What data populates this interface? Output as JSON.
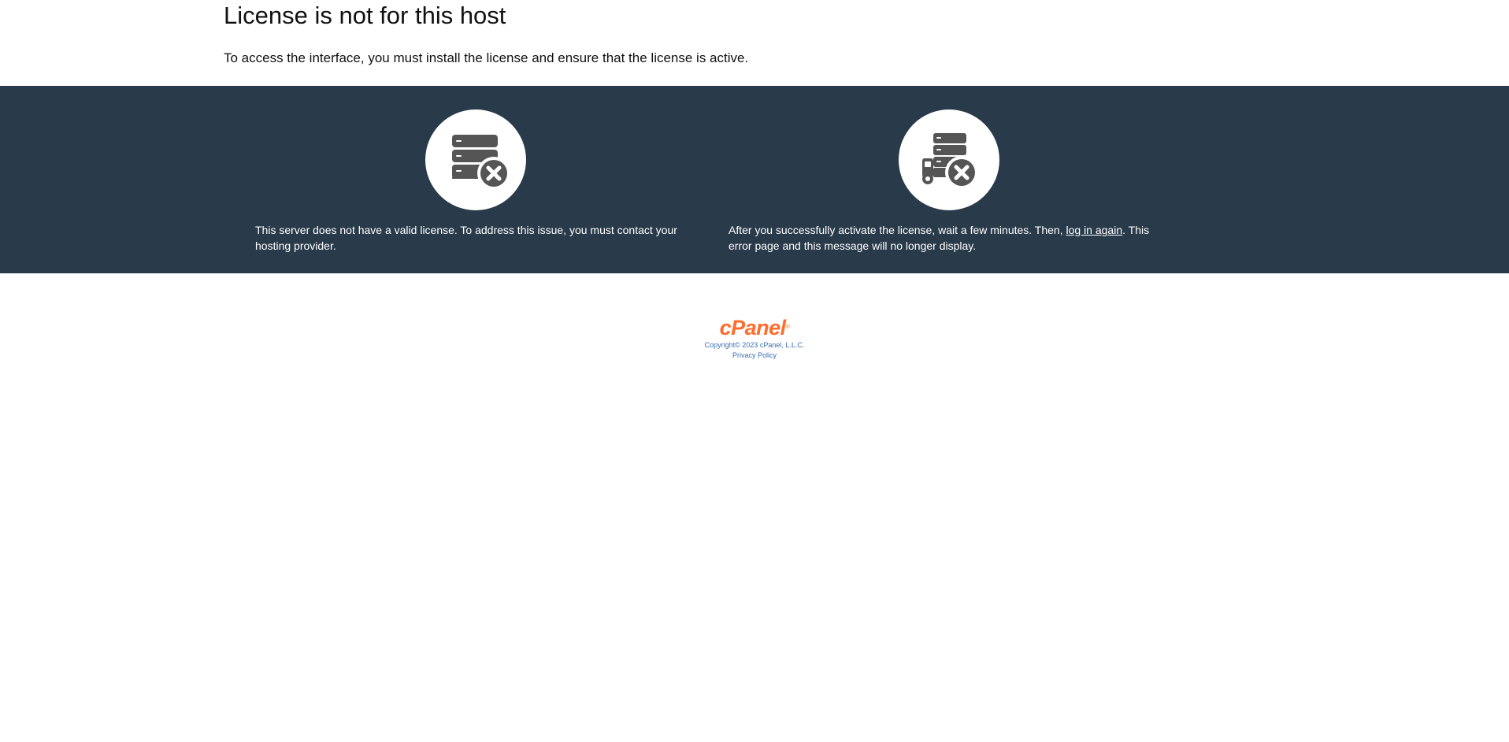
{
  "header": {
    "title": "License is not for this host",
    "subtitle": "To access the interface, you must install the license and ensure that the license is active."
  },
  "cards": {
    "left": {
      "icon": "server-error-icon",
      "text": "This server does not have a valid license. To address this issue, you must contact your hosting provider."
    },
    "right": {
      "icon": "server-truck-error-icon",
      "text_before": "After you successfully activate the license, wait a few minutes. Then, ",
      "link": "log in again",
      "text_after": ". This error page and this message will no longer display."
    }
  },
  "footer": {
    "logo": "cPanel",
    "logo_mark": "®",
    "copyright": "Copyright© 2023 cPanel, L.L.C.",
    "privacy": "Privacy Policy"
  },
  "colors": {
    "band": "#293a4a",
    "brand": "#ff6c2c",
    "link": "#3a6fb0",
    "icon": "#555555"
  }
}
